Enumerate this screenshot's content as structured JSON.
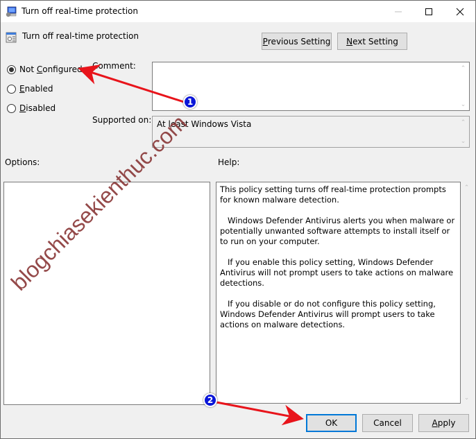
{
  "window": {
    "title": "Turn off real-time protection",
    "controls": {
      "minimize": "minimize",
      "maximize": "maximize",
      "close": "close"
    }
  },
  "header": {
    "policy_title": "Turn off real-time protection",
    "previous_button": {
      "underline": "P",
      "rest": "revious Setting"
    },
    "next_button": {
      "underline": "N",
      "rest": "ext Setting"
    }
  },
  "state": {
    "options": [
      {
        "pre": "Not ",
        "underline": "C",
        "post": "onfigured",
        "checked": true
      },
      {
        "pre": "",
        "underline": "E",
        "post": "nabled",
        "checked": false
      },
      {
        "pre": "",
        "underline": "D",
        "post": "isabled",
        "checked": false
      }
    ]
  },
  "fields": {
    "comment_label": "Comment:",
    "comment_value": "",
    "supported_label": "Supported on:",
    "supported_value": "At least Windows Vista"
  },
  "sections": {
    "options_label": "Options:",
    "help_label": "Help:"
  },
  "help": {
    "paragraphs": [
      "This policy setting turns off real-time protection prompts for known malware detection.",
      "Windows Defender Antivirus alerts you when malware or potentially unwanted software attempts to install itself or to run on your computer.",
      "If you enable this policy setting, Windows Defender Antivirus will not prompt users to take actions on malware detections.",
      "If you disable or do not configure this policy setting, Windows Defender Antivirus will prompt users to take actions on malware detections."
    ]
  },
  "footer": {
    "ok": "OK",
    "cancel": "Cancel",
    "apply": {
      "underline": "A",
      "rest": "pply"
    }
  },
  "annotations": {
    "badge_1": "1",
    "badge_2": "2",
    "arrow_color": "#e8141b",
    "badge_color": "#0a16d8"
  },
  "watermark": "blogchiasekienthuc.com"
}
